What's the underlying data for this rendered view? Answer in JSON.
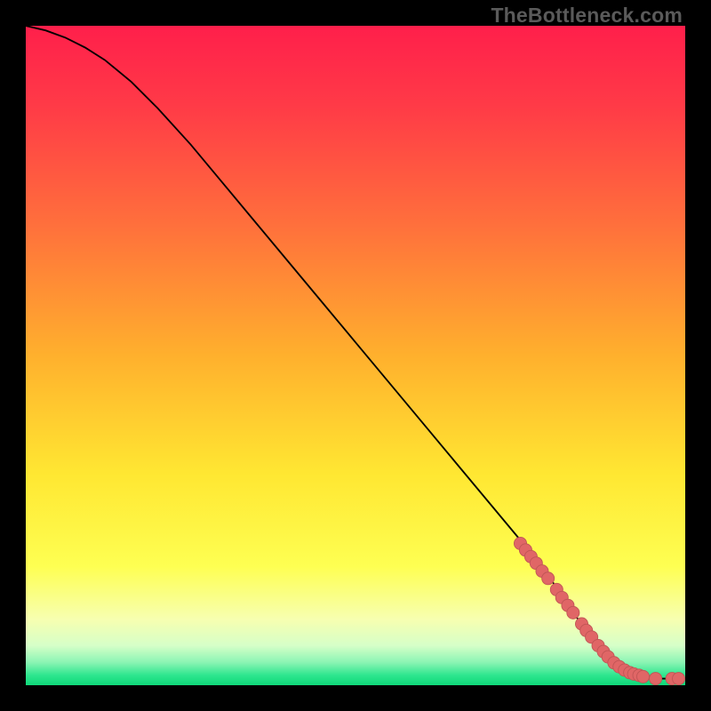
{
  "watermark": "TheBottleneck.com",
  "colors": {
    "frame": "#000000",
    "curve": "#000000",
    "marker": "#e06666",
    "marker_stroke": "#c05555"
  },
  "chart_data": {
    "type": "line",
    "title": "",
    "xlabel": "",
    "ylabel": "",
    "xlim": [
      0,
      100
    ],
    "ylim": [
      0,
      100
    ],
    "gradient_stops": [
      {
        "pos": 0.0,
        "color": "#ff1f4b"
      },
      {
        "pos": 0.12,
        "color": "#ff3a47"
      },
      {
        "pos": 0.3,
        "color": "#ff6f3c"
      },
      {
        "pos": 0.5,
        "color": "#ffb02d"
      },
      {
        "pos": 0.68,
        "color": "#ffe732"
      },
      {
        "pos": 0.82,
        "color": "#feff52"
      },
      {
        "pos": 0.9,
        "color": "#f7ffb0"
      },
      {
        "pos": 0.94,
        "color": "#d6ffc8"
      },
      {
        "pos": 0.965,
        "color": "#8cf5b4"
      },
      {
        "pos": 0.985,
        "color": "#2de68e"
      },
      {
        "pos": 1.0,
        "color": "#0fd879"
      }
    ],
    "series": [
      {
        "name": "curve",
        "x": [
          0,
          3,
          6,
          9,
          12,
          16,
          20,
          25,
          30,
          35,
          40,
          45,
          50,
          55,
          60,
          65,
          70,
          75,
          80,
          83,
          86,
          88,
          90,
          92,
          94,
          96,
          98,
          100
        ],
        "y": [
          100,
          99.3,
          98.2,
          96.7,
          94.8,
          91.5,
          87.5,
          82,
          76,
          70,
          64,
          58,
          52,
          46,
          40,
          34,
          28,
          22,
          15.5,
          11,
          7,
          4.5,
          2.8,
          1.8,
          1.2,
          1.0,
          1.0,
          1.0
        ]
      }
    ],
    "markers": [
      {
        "x": 75.0,
        "y": 21.5
      },
      {
        "x": 75.8,
        "y": 20.5
      },
      {
        "x": 76.6,
        "y": 19.5
      },
      {
        "x": 77.4,
        "y": 18.5
      },
      {
        "x": 78.3,
        "y": 17.3
      },
      {
        "x": 79.2,
        "y": 16.2
      },
      {
        "x": 80.5,
        "y": 14.5
      },
      {
        "x": 81.3,
        "y": 13.3
      },
      {
        "x": 82.2,
        "y": 12.1
      },
      {
        "x": 83.0,
        "y": 11.0
      },
      {
        "x": 84.3,
        "y": 9.3
      },
      {
        "x": 85.0,
        "y": 8.3
      },
      {
        "x": 85.8,
        "y": 7.3
      },
      {
        "x": 86.8,
        "y": 6.0
      },
      {
        "x": 87.6,
        "y": 5.1
      },
      {
        "x": 88.3,
        "y": 4.3
      },
      {
        "x": 89.2,
        "y": 3.4
      },
      {
        "x": 90.0,
        "y": 2.8
      },
      {
        "x": 90.8,
        "y": 2.3
      },
      {
        "x": 91.6,
        "y": 1.9
      },
      {
        "x": 92.2,
        "y": 1.7
      },
      {
        "x": 93.0,
        "y": 1.5
      },
      {
        "x": 93.6,
        "y": 1.3
      },
      {
        "x": 95.5,
        "y": 1.0
      },
      {
        "x": 98.0,
        "y": 1.0
      },
      {
        "x": 99.0,
        "y": 1.0
      }
    ],
    "marker_radius_pct": 0.95
  }
}
